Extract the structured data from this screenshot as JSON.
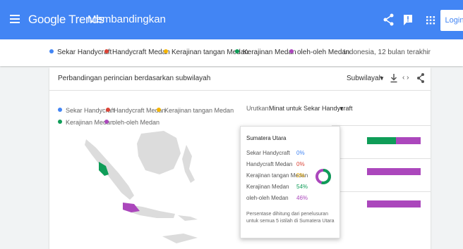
{
  "header": {
    "menu_icon": "menu-icon",
    "logo": "Google Trends",
    "title": "Membandingkan",
    "login": "Login",
    "bg_color": "#4285f4"
  },
  "terms": [
    {
      "label": "Sekar Handycraft",
      "color": "#4285f4"
    },
    {
      "label": "Handycraft Medan",
      "color": "#db4437"
    },
    {
      "label": "Kerajinan tangan Medan",
      "color": "#f4b400"
    },
    {
      "label": "Kerajinan Medan",
      "color": "#0f9d58"
    },
    {
      "label": "oleh-oleh Medan",
      "color": "#ab47bc"
    }
  ],
  "filter": {
    "region_time": "Indonesia, 12 bulan terakhir"
  },
  "card": {
    "title": "Perbandingan perincian berdasarkan subwilayah",
    "subregion": "Subwilayah",
    "legend": [
      {
        "label": "Sekar Handycraft",
        "color": "#4285f4"
      },
      {
        "label": "Handycraft Medan",
        "color": "#db4437"
      },
      {
        "label": "Kerajinan tangan Medan",
        "color": "#f4b400"
      },
      {
        "label": "Kerajinan Medan",
        "color": "#0f9d58"
      },
      {
        "label": "oleh-oleh Medan",
        "color": "#ab47bc"
      }
    ],
    "sort_label": "Urutkan:",
    "sort_value": "Minat untuk Sekar Handycraft"
  },
  "bars": [
    {
      "segments": [
        {
          "color": "#0f9d58",
          "share": 0.54
        },
        {
          "color": "#ab47bc",
          "share": 0.46
        }
      ]
    },
    {
      "segments": [
        {
          "color": "#ab47bc",
          "share": 1.0
        }
      ]
    },
    {
      "segments": [
        {
          "color": "#ab47bc",
          "share": 1.0
        }
      ]
    }
  ],
  "tooltip": {
    "title": "Sumatera Utara",
    "rows": [
      {
        "label": "Sekar Handycraft",
        "value": "0%",
        "color": "#4285f4"
      },
      {
        "label": "Handycraft Medan",
        "value": "0%",
        "color": "#db4437"
      },
      {
        "label": "Kerajinan tangan Medan",
        "value": "0%",
        "color": "#f4b400"
      },
      {
        "label": "Kerajinan Medan",
        "value": "54%",
        "color": "#0f9d58"
      },
      {
        "label": "oleh-oleh Medan",
        "value": "46%",
        "color": "#ab47bc"
      }
    ],
    "note": "Persentase dihitung dari penelusuran untuk semua 5 istilah di Sumatera Utara"
  }
}
